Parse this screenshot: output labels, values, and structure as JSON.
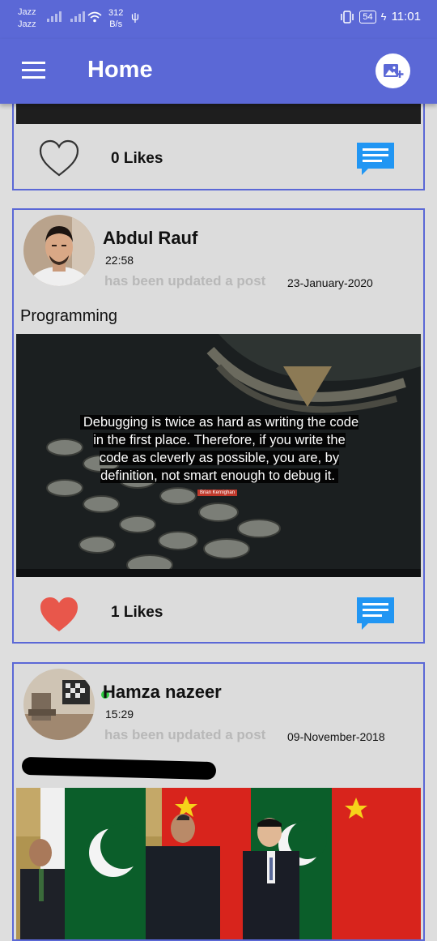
{
  "status_bar": {
    "carrier_1": "Jazz",
    "carrier_2": "Jazz",
    "speed_value": "312",
    "speed_unit": "B/s",
    "battery": "54",
    "time": "11:01"
  },
  "appbar": {
    "title": "Home",
    "menu_icon": "hamburger-menu-icon",
    "add_icon": "add-photo-icon"
  },
  "posts": [
    {
      "likes_label": "0 Likes",
      "liked": false
    },
    {
      "author": "Abdul Rauf",
      "time": "22:58",
      "action": "has been updated a post",
      "date": "23-January-2020",
      "text": "Programming",
      "image_quote": "Debugging is twice as hard as writing the code in the first place. Therefore, if you write the code as cleverly as possible, you are, by definition, not smart enough to debug it.",
      "image_author": "Brian Kernighan",
      "likes_label": "1 Likes",
      "liked": true
    },
    {
      "author": "Hamza nazeer",
      "time": "15:29",
      "action": "has been updated a post",
      "date": "09-November-2018",
      "text": ""
    }
  ],
  "colors": {
    "primary": "#5b68d6",
    "like_active": "#e8574b",
    "comment_icon": "#2196f3",
    "background": "#dedede"
  }
}
